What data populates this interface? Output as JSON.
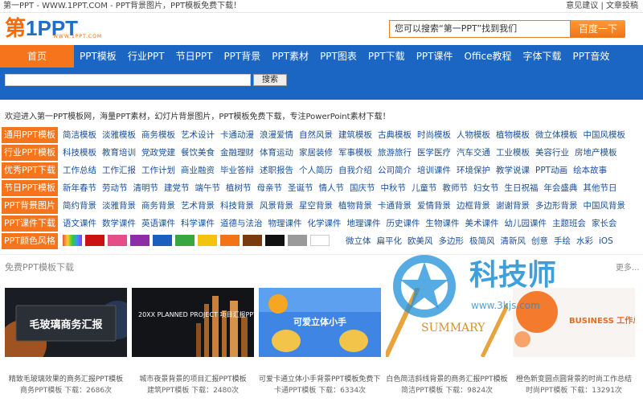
{
  "topbar": {
    "left": "第一PPT - WWW.1PPT.COM - PPT背景图片，PPT模板免费下载！",
    "right_1": "意见建议",
    "sep": "|",
    "right_2": "文章投稿"
  },
  "logo": {
    "part1": "第",
    "part2": "1PPT",
    "sub": "WWW.1PPT.COM"
  },
  "search": {
    "placeholder": "您可以搜索“第一PPT”找到我们",
    "button": "百度一下"
  },
  "nav": {
    "home": "首页",
    "items": [
      "PPT模板",
      "行业PPT",
      "节日PPT",
      "PPT背景",
      "PPT素材",
      "PPT图表",
      "PPT下载",
      "PPT课件",
      "Office教程",
      "字体下载",
      "PPT音效"
    ]
  },
  "band": {
    "button": "搜索"
  },
  "welcome": "欢迎进入第一PPT模板网，海量PPT素材，幻灯片背景图片，PPT模板免费下载，专注PowerPoint素材下载！",
  "categories": [
    {
      "label": "通用PPT模板",
      "links": [
        "简洁模板",
        "淡雅模板",
        "商务模板",
        "艺术设计",
        "卡通动漫",
        "浪漫爱情",
        "自然风景",
        "建筑模板",
        "古典模板",
        "时尚模板",
        "人物模板",
        "植物模板",
        "微立体模板",
        "中国风模板"
      ]
    },
    {
      "label": "行业PPT模板",
      "links": [
        "科技模板",
        "教育培训",
        "党政党建",
        "餐饮美食",
        "金融理财",
        "体育运动",
        "家居装修",
        "军事模板",
        "旅游旅行",
        "医学医疗",
        "汽车交通",
        "工业模板",
        "美容行业",
        "房地产模板"
      ]
    },
    {
      "label": "优秀PPT下载",
      "links": [
        "工作总结",
        "工作汇报",
        "工作计划",
        "商业融资",
        "毕业答辩",
        "述职报告",
        "个人简历",
        "自我介绍",
        "公司简介",
        "培训课件",
        "环境保护",
        "教学说课",
        "PPT动画",
        "绘本故事"
      ]
    },
    {
      "label": "节日PPT模板",
      "links": [
        "新年春节",
        "劳动节",
        "清明节",
        "建党节",
        "端午节",
        "植树节",
        "母亲节",
        "圣诞节",
        "情人节",
        "国庆节",
        "中秋节",
        "儿童节",
        "教师节",
        "妇女节",
        "生日祝福",
        "年会盛典",
        "其他节日"
      ]
    },
    {
      "label": "PPT背景图片",
      "links": [
        "简约背景",
        "淡雅背景",
        "商务背景",
        "艺术背景",
        "科技背景",
        "风景背景",
        "星空背景",
        "植物背景",
        "卡通背景",
        "爱情背景",
        "边框背景",
        "谢谢背景",
        "多边形背景",
        "中国风背景"
      ]
    },
    {
      "label": "PPT课件下载",
      "links": [
        "语文课件",
        "数学课件",
        "英语课件",
        "科学课件",
        "道德与法治",
        "物理课件",
        "化学课件",
        "地理课件",
        "历史课件",
        "生物课件",
        "美术课件",
        "幼儿园课件",
        "主题班会",
        "家长会"
      ]
    },
    {
      "label": "PPT颜色风格",
      "links": [
        "微立体",
        "扁平化",
        "欧美风",
        "多边形",
        "极简风",
        "清新风",
        "创意",
        "手绘",
        "水彩",
        "iOS"
      ]
    }
  ],
  "colors": [
    "#cc1111",
    "#e44f8a",
    "#8e2ea6",
    "#1a5fc0",
    "#3aa640",
    "#f2c40f",
    "#f27416",
    "#7a3b10",
    "#111111",
    "#9a9a9a",
    "#ffffff"
  ],
  "section": {
    "title": "免费PPT模板下载",
    "more": "更多..."
  },
  "cards": [
    {
      "thumb_text": "毛玻璃商务汇报",
      "title": "精致毛玻璃效果的商务汇报PPT模板",
      "meta": "商务PPT模板  下载：2686次"
    },
    {
      "thumb_text": "20XX PLANNED PROJECT 项目汇报PPT模板",
      "title": "城市夜景背景的项目汇报PPT模板",
      "meta": "建筑PPT模板  下载：2480次"
    },
    {
      "thumb_text": "可爱立体小手",
      "title": "可爱卡通立体小手背景PPT模板免费下载",
      "meta": "卡通PPT模板  下载：6334次"
    },
    {
      "thumb_text": "SUMMARY",
      "title": "白色简洁斜线背景的商务汇报PPT模板",
      "meta": "简洁PPT模板  下载：9824次"
    },
    {
      "thumb_text": "BUSINESS 工作总结模板",
      "title": "橙色新变圆点圆背景的时尚工作总结",
      "meta": "时尚PPT模板  下载：13291次"
    }
  ],
  "watermark": {
    "text": "科技师",
    "url": "www.3kjs.com"
  }
}
